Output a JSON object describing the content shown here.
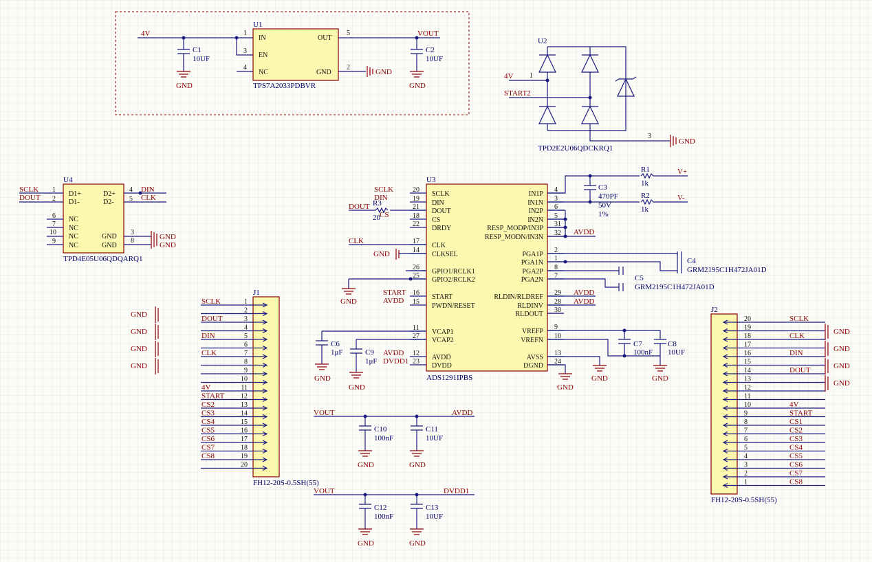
{
  "nets": {
    "pwr_4v": "4V",
    "vout": "VOUT",
    "gnd": "GND",
    "avdd": "AVDD",
    "dvdd1": "DVDD1",
    "sclk": "SCLK",
    "dout": "DOUT",
    "din": "DIN",
    "clk": "CLK",
    "start": "START",
    "cs": "CS",
    "start2": "START2",
    "vplus": "V+",
    "vminus": "V-",
    "cs1": "CS1",
    "cs2": "CS2",
    "cs3": "CS3",
    "cs4": "CS4",
    "cs5": "CS5",
    "cs6": "CS6",
    "cs7": "CS7",
    "cs8": "CS8"
  },
  "u1": {
    "ref": "U1",
    "part": "TPS7A2033PDBVR",
    "pins": {
      "in": "IN",
      "en": "EN",
      "nc": "NC",
      "out": "OUT",
      "gnd": "GND"
    },
    "nums": {
      "in": "1",
      "en": "3",
      "nc": "4",
      "out": "5",
      "gnd": "2"
    }
  },
  "u2": {
    "ref": "U2",
    "part": "TPD2E2U06QDCKRQ1",
    "nums": {
      "p1": "1",
      "p2": "2",
      "p3": "3"
    }
  },
  "u4": {
    "ref": "U4",
    "part": "TPD4E05U06QDQARQ1",
    "pins": {
      "d1p": "D1+",
      "d1m": "D1-",
      "d2p": "D2+",
      "d2m": "D2-",
      "nc": "NC",
      "gnd": "GND"
    },
    "nums": {
      "n1": "1",
      "n2": "2",
      "n4": "4",
      "n5": "5",
      "n6": "6",
      "n7": "7",
      "n10": "10",
      "n9": "9",
      "n3": "3",
      "n8": "8"
    }
  },
  "u3": {
    "ref": "U3",
    "part": "ADS1291IPBS",
    "left": [
      {
        "n": "20",
        "name": "SCLK"
      },
      {
        "n": "19",
        "name": "DIN"
      },
      {
        "n": "21",
        "name": "DOUT"
      },
      {
        "n": "18",
        "name": "CS"
      },
      {
        "n": "22",
        "name": "DRDY"
      },
      {
        "n": "17",
        "name": "CLK"
      },
      {
        "n": "14",
        "name": "CLKSEL"
      },
      {
        "n": "26",
        "name": "GPIO1/RCLK1"
      },
      {
        "n": "25",
        "name": "GPIO2/RCLK2"
      },
      {
        "n": "16",
        "name": "START"
      },
      {
        "n": "15",
        "name": "PWDN/RESET"
      },
      {
        "n": "11",
        "name": "VCAP1"
      },
      {
        "n": "27",
        "name": "VCAP2"
      },
      {
        "n": "12",
        "name": "AVDD"
      },
      {
        "n": "23",
        "name": "DVDD"
      }
    ],
    "right": [
      {
        "n": "4",
        "name": "IN1P"
      },
      {
        "n": "3",
        "name": "IN1N"
      },
      {
        "n": "6",
        "name": "IN2P"
      },
      {
        "n": "5",
        "name": "IN2N"
      },
      {
        "n": "31",
        "name": "RESP_MODP/IN3P"
      },
      {
        "n": "32",
        "name": "RESP_MODN/IN3N"
      },
      {
        "n": "2",
        "name": "PGA1P"
      },
      {
        "n": "1",
        "name": "PGA1N"
      },
      {
        "n": "8",
        "name": "PGA2P"
      },
      {
        "n": "7",
        "name": "PGA2N"
      },
      {
        "n": "29",
        "name": "RLDIN/RLDREF"
      },
      {
        "n": "28",
        "name": "RLDINV"
      },
      {
        "n": "30",
        "name": "RLDOUT"
      },
      {
        "n": "9",
        "name": "VREFP"
      },
      {
        "n": "10",
        "name": "VREFN"
      },
      {
        "n": "13",
        "name": "AVSS"
      },
      {
        "n": "24",
        "name": "DGND"
      }
    ]
  },
  "caps": {
    "c1": {
      "ref": "C1",
      "val": "10UF"
    },
    "c2": {
      "ref": "C2",
      "val": "10UF"
    },
    "c3": {
      "ref": "C3",
      "val": "470PF",
      "v": "50V",
      "tol": "1%"
    },
    "c4": {
      "ref": "C4",
      "val": "GRM2195C1H472JA01D"
    },
    "c5": {
      "ref": "C5",
      "val": "GRM2195C1H472JA01D"
    },
    "c6": {
      "ref": "C6",
      "val": "1μF"
    },
    "c9": {
      "ref": "C9",
      "val": "1μF"
    },
    "c7": {
      "ref": "C7",
      "val": "100nF"
    },
    "c8": {
      "ref": "C8",
      "val": "10UF"
    },
    "c10": {
      "ref": "C10",
      "val": "100nF"
    },
    "c11": {
      "ref": "C11",
      "val": "10UF"
    },
    "c12": {
      "ref": "C12",
      "val": "100nF"
    },
    "c13": {
      "ref": "C13",
      "val": "10UF"
    }
  },
  "res": {
    "r1": {
      "ref": "R1",
      "val": "1k"
    },
    "r2": {
      "ref": "R2",
      "val": "1k"
    },
    "r3": {
      "ref": "R3",
      "val": "20"
    }
  },
  "j1": {
    "ref": "J1",
    "part": "FH12-20S-0.5SH(55)",
    "nets": [
      "SCLK",
      "",
      "DOUT",
      "",
      "DIN",
      "",
      "CLK",
      "",
      "",
      "",
      "4V",
      "START",
      "CS2",
      "CS3",
      "CS4",
      "CS5",
      "CS6",
      "CS7",
      "CS8",
      ""
    ]
  },
  "j2": {
    "ref": "J2",
    "part": "FH12-20S-0.5SH(55)",
    "nets": [
      "SCLK",
      "",
      "CLK",
      "",
      "DIN",
      "",
      "DOUT",
      "",
      "",
      "",
      "4V",
      "START",
      "CS1",
      "CS2",
      "CS3",
      "CS4",
      "CS5",
      "CS6",
      "CS7",
      "CS8"
    ]
  }
}
